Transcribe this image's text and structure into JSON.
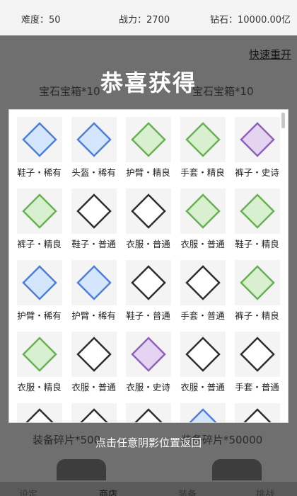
{
  "topbar": {
    "difficulty": "难度：50",
    "power": "战力：2700",
    "gems": "钻石：10000.00亿"
  },
  "background": {
    "quick_restart": "快速重开",
    "box_left": "宝石宝箱*10",
    "box_right": "宝石宝箱*10",
    "fragment_left": "装备碎片*500",
    "fragment_right": "装备碎片*50000"
  },
  "dialog": {
    "title": "恭喜获得",
    "close_hint": "点击任意阴影位置返回"
  },
  "colors": {
    "rare": "#4f7fd0",
    "rare_fill": "#d4e6fb",
    "fine": "#6aaf56",
    "fine_fill": "#d8efd0",
    "epic": "#8e62b8",
    "epic_fill": "#e4d3f1",
    "common": "#2e2e2e",
    "common_fill": "#ffffff"
  },
  "items": [
    {
      "label": "鞋子・稀有",
      "rarity": "rare"
    },
    {
      "label": "头盔・稀有",
      "rarity": "rare"
    },
    {
      "label": "护臂・精良",
      "rarity": "fine"
    },
    {
      "label": "手套・精良",
      "rarity": "fine"
    },
    {
      "label": "裤子・史诗",
      "rarity": "epic"
    },
    {
      "label": "裤子・精良",
      "rarity": "fine"
    },
    {
      "label": "鞋子・普通",
      "rarity": "common"
    },
    {
      "label": "衣服・普通",
      "rarity": "common"
    },
    {
      "label": "衣服・普通",
      "rarity": "fine"
    },
    {
      "label": "鞋子・精良",
      "rarity": "fine"
    },
    {
      "label": "护臂・稀有",
      "rarity": "rare"
    },
    {
      "label": "护臂・稀有",
      "rarity": "rare"
    },
    {
      "label": "鞋子・普通",
      "rarity": "common"
    },
    {
      "label": "手套・普通",
      "rarity": "common"
    },
    {
      "label": "裤子・精良",
      "rarity": "fine"
    },
    {
      "label": "衣服・精良",
      "rarity": "fine"
    },
    {
      "label": "衣服・普通",
      "rarity": "common"
    },
    {
      "label": "衣服・史诗",
      "rarity": "epic"
    },
    {
      "label": "衣服・普通",
      "rarity": "common"
    },
    {
      "label": "手套・普通",
      "rarity": "common"
    },
    {
      "label": "",
      "rarity": "common"
    },
    {
      "label": "",
      "rarity": "common"
    },
    {
      "label": "",
      "rarity": "common"
    },
    {
      "label": "",
      "rarity": "rare"
    },
    {
      "label": "",
      "rarity": "common"
    }
  ],
  "tabs": {
    "settings": "设定",
    "shop": "商店",
    "equip": "装备",
    "challenge": "挑战"
  }
}
